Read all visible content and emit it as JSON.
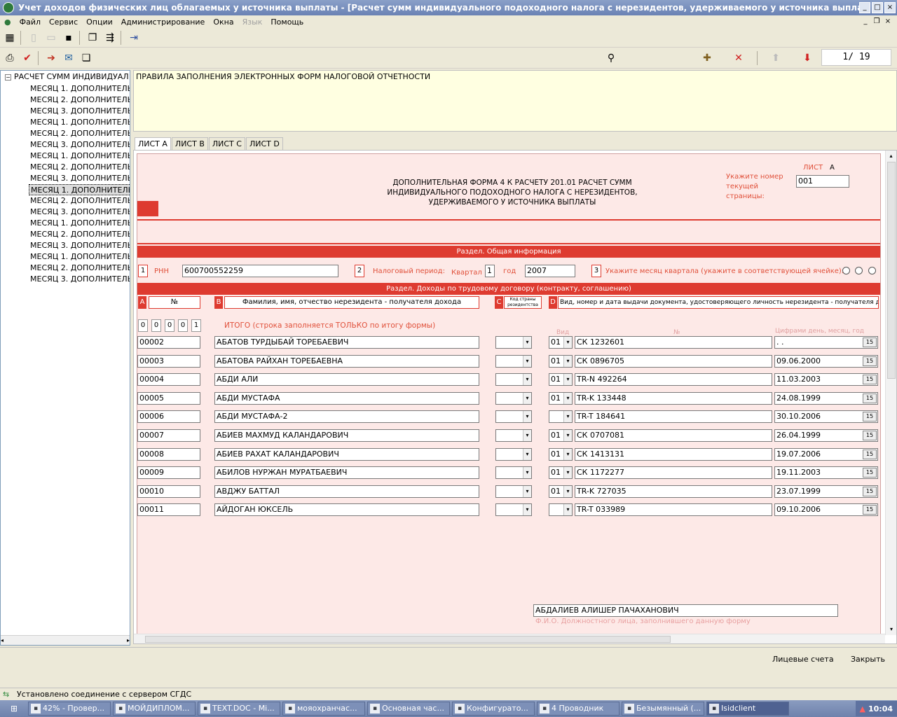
{
  "window": {
    "title": "Учет доходов физических лиц облагаемых у источника выплаты - [Расчет сумм индивидуального подоходного налога с нерезидентов, удерживаемого у источника выплаты]"
  },
  "menu": [
    "Файл",
    "Сервис",
    "Опции",
    "Администрирование",
    "Окна",
    "Язык",
    "Помощь"
  ],
  "toolbar": {
    "page_counter": "1/ 19"
  },
  "tree": {
    "root": "РАСЧЕТ СУММ ИНДИВИДУАЛ",
    "items": [
      "МЕСЯЦ 1. ДОПОЛНИТЕЛЬ",
      "МЕСЯЦ 2. ДОПОЛНИТЕЛЬ",
      "МЕСЯЦ 3. ДОПОЛНИТЕЛЬ",
      "МЕСЯЦ 1. ДОПОЛНИТЕЛЬ",
      "МЕСЯЦ 2. ДОПОЛНИТЕЛЬ",
      "МЕСЯЦ 3. ДОПОЛНИТЕЛЬ",
      "МЕСЯЦ 1. ДОПОЛНИТЕЛЬ",
      "МЕСЯЦ 2. ДОПОЛНИТЕЛЬ",
      "МЕСЯЦ 3. ДОПОЛНИТЕЛЬ",
      "МЕСЯЦ 1. ДОПОЛНИТЕЛЬ",
      "МЕСЯЦ 2. ДОПОЛНИТЕЛЬ",
      "МЕСЯЦ 3. ДОПОЛНИТЕЛЬ",
      "МЕСЯЦ 1. ДОПОЛНИТЕЛЬ",
      "МЕСЯЦ 2. ДОПОЛНИТЕЛЬ",
      "МЕСЯЦ 3. ДОПОЛНИТЕЛЬ",
      "МЕСЯЦ 1. ДОПОЛНИТЕЛЬ",
      "МЕСЯЦ 2. ДОПОЛНИТЕЛЬ",
      "МЕСЯЦ 3. ДОПОЛНИТЕЛЬ"
    ],
    "selected_index": 9
  },
  "rules_text": "ПРАВИЛА ЗАПОЛНЕНИЯ ЭЛЕКТРОННЫХ ФОРМ НАЛОГОВОЙ ОТЧЕТНОСТИ",
  "tabs": [
    "ЛИСТ А",
    "ЛИСТ В",
    "ЛИСТ С",
    "ЛИСТ D"
  ],
  "form": {
    "header_line1": "ДОПОЛНИТЕЛЬНАЯ ФОРМА 4 К РАСЧЕТУ 201.01 РАСЧЕТ СУММ",
    "header_line2": "ИНДИВИДУАЛЬНОГО ПОДОХОДНОГО НАЛОГА С НЕРЕЗИДЕНТОВ,",
    "header_line3": "УДЕРЖИВАЕМОГО У ИСТОЧНИКА ВЫПЛАТЫ",
    "sheet_label": "ЛИСТ",
    "sheet_letter": "А",
    "page_hint_l1": "Укажите номер",
    "page_hint_l2": "текущей",
    "page_hint_l3": "страницы:",
    "page_number": "001",
    "section_general": "Раздел. Общая информация",
    "n1": "1",
    "rnn_label": "РНН",
    "rnn_value": "600700552259",
    "n2": "2",
    "period_label": "Налоговый период:",
    "quarter_label": "Квартал",
    "quarter_value": "1",
    "year_label": "год",
    "year_value": "2007",
    "n3": "3",
    "month_label": "Укажите месяц квартала  (укажите в соответствующей ячейке):",
    "section_income": "Раздел. Доходы по трудовому договору (контракту, соглашению)",
    "colA": "A",
    "colA_label": "№",
    "colB": "B",
    "colB_label": "Фамилия, имя, отчество нерезидента - получателя дохода",
    "colC": "C",
    "colC_label": "Код страны резидентства",
    "colD": "D",
    "colD_label": "Вид, номер и дата выдачи документа, удостоверяющего личность нерезидента - получателя доходов",
    "total_digits": [
      "0",
      "0",
      "0",
      "0",
      "1"
    ],
    "total_label": "ИТОГО (строка заполняется ТОЛЬКО по итогу формы)",
    "sub_kind": "Вид",
    "sub_num": "№",
    "sub_date": "Цифрами день, месяц, год",
    "rows": [
      {
        "num": "00002",
        "name": "АБАТОВ ТУРДЫБАЙ ТОРЕБАЕВИЧ",
        "country": "",
        "kind": "01",
        "doc": "СК 1232601",
        "date": "  .  ."
      },
      {
        "num": "00003",
        "name": "АБАТОВА РАЙХАН ТОРЕБАЕВНА",
        "country": "",
        "kind": "01",
        "doc": "СК 0896705",
        "date": "09.06.2000"
      },
      {
        "num": "00004",
        "name": "АБДИ АЛИ",
        "country": "",
        "kind": "01",
        "doc": "TR-N 492264",
        "date": "11.03.2003"
      },
      {
        "num": "00005",
        "name": "АБДИ МУСТАФА",
        "country": "",
        "kind": "01",
        "doc": "TR-K 133448",
        "date": "24.08.1999"
      },
      {
        "num": "00006",
        "name": "АБДИ МУСТАФА-2",
        "country": "",
        "kind": "",
        "doc": "TR-T 184641",
        "date": "30.10.2006"
      },
      {
        "num": "00007",
        "name": "АБИЕВ МАХМУД КАЛАНДАРОВИЧ",
        "country": "",
        "kind": "01",
        "doc": "СК 0707081",
        "date": "26.04.1999"
      },
      {
        "num": "00008",
        "name": "АБИЕВ РАХАТ КАЛАНДАРОВИЧ",
        "country": "",
        "kind": "01",
        "doc": "СК 1413131",
        "date": "19.07.2006"
      },
      {
        "num": "00009",
        "name": "АБИЛОВ НУРЖАН МУРАТБАЕВИЧ",
        "country": "",
        "kind": "01",
        "doc": "СК 1172277",
        "date": "19.11.2003"
      },
      {
        "num": "00010",
        "name": "АВДЖУ БАТТАЛ",
        "country": "",
        "kind": "01",
        "doc": "TR-K 727035",
        "date": "23.07.1999"
      },
      {
        "num": "00011",
        "name": "АЙДОГАН ЮКСЕЛЬ",
        "country": "",
        "kind": "",
        "doc": "TR-T 033989",
        "date": "09.10.2006"
      }
    ],
    "officer_name": "АБДАЛИЕВ АЛИШЕР ПАЧАХАНОВИЧ",
    "officer_label": "Ф.И.О. Должностного лица, заполнившего данную форму"
  },
  "bottom": {
    "accounts": "Лицевые счета",
    "close": "Закрыть"
  },
  "status": {
    "text": "Установлено соединение с сервером СГДС"
  },
  "taskbar": {
    "tasks": [
      "42% - Провер...",
      "МОЙДИПЛОМ...",
      "TEXT.DOC - Mi...",
      "мояохранчас...",
      "Основная час...",
      "Конфигурато...",
      "4 Проводник",
      "Безымянный (...",
      "Isidclient"
    ],
    "clock": "10:04"
  },
  "colors": {
    "form_bg": "#fde9e7",
    "accent_red": "#de3b30",
    "label_red": "#e0503a",
    "hint_yellow": "#ffffe1"
  }
}
